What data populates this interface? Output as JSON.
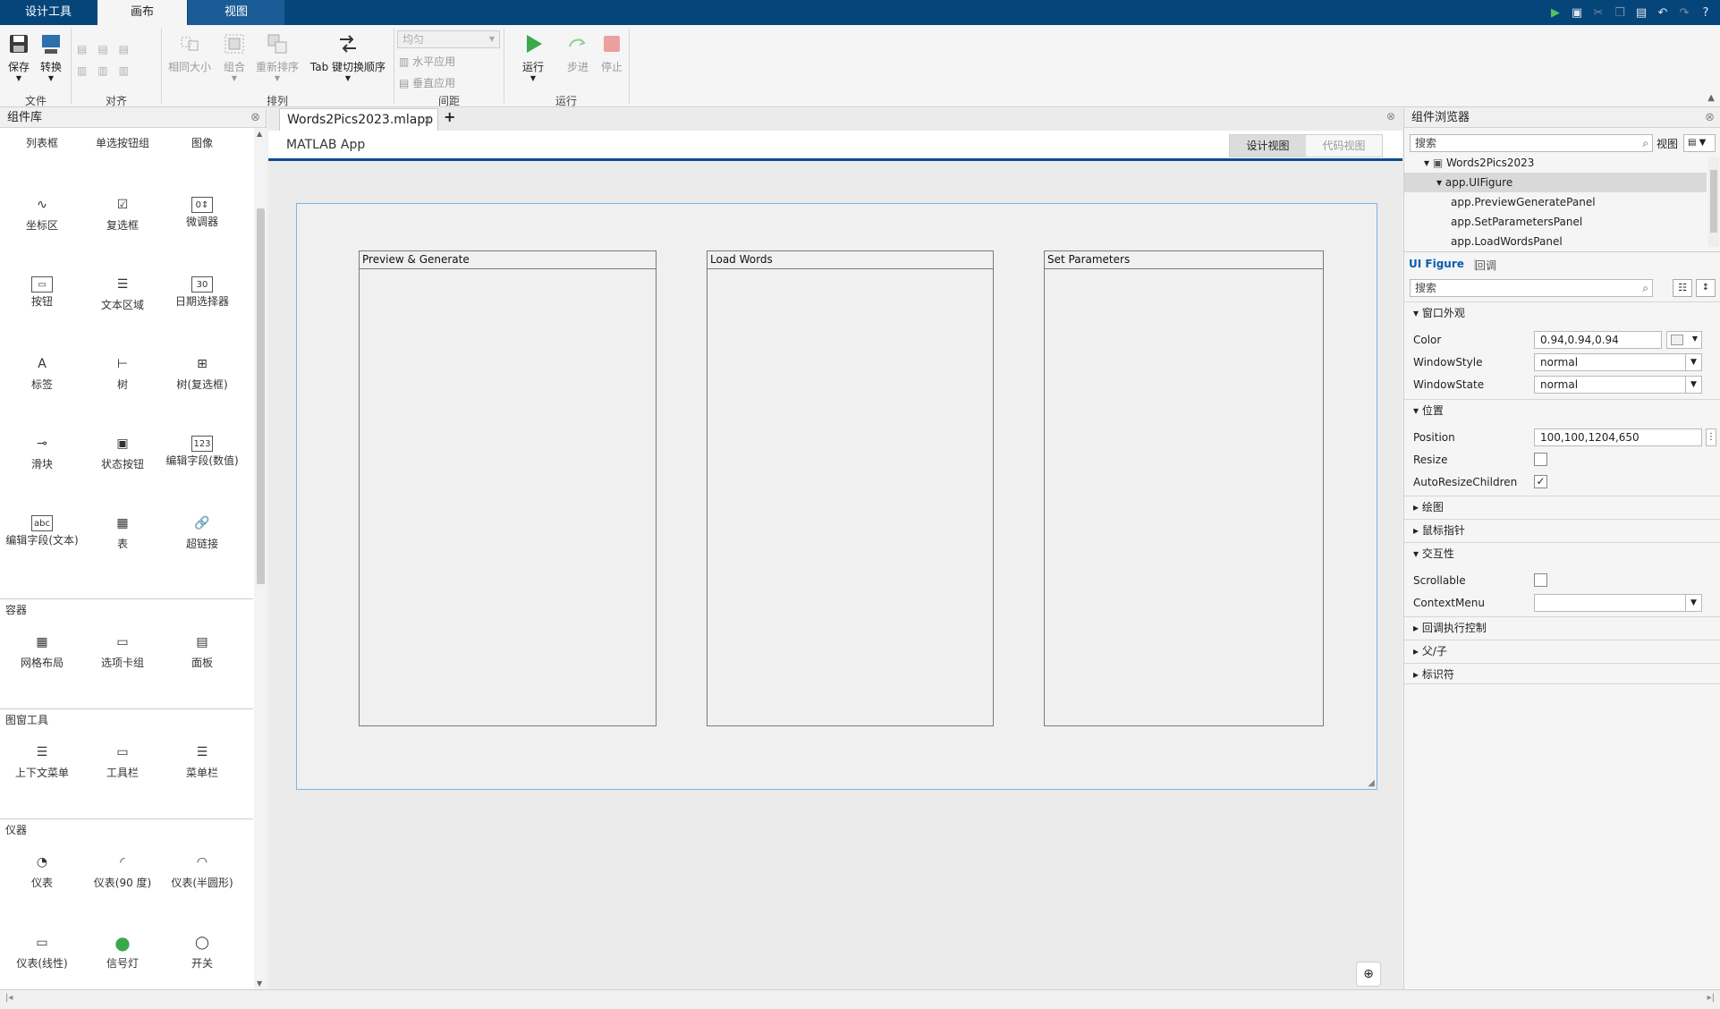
{
  "ribbon_tabs": [
    "设计工具",
    "画布",
    "视图"
  ],
  "ribbon": {
    "save": "保存",
    "convert": "转换",
    "file_group": "文件",
    "align_group": "对齐",
    "same_size": "相同大小",
    "group": "组合",
    "reorder": "重新排序",
    "tab_order": "Tab 键切换顺序",
    "arrange_group": "排列",
    "distribute_value": "均匀",
    "apply_horizontal": "水平应用",
    "apply_vertical": "垂直应用",
    "spacing_group": "间距",
    "run": "运行",
    "step": "步进",
    "stop": "停止",
    "run_group": "运行"
  },
  "library": {
    "title": "组件库",
    "partial": [
      "列表框",
      "单选按钮组",
      "图像"
    ],
    "items": [
      {
        "label": "坐标区",
        "icon": "axes-icon"
      },
      {
        "label": "复选框",
        "icon": "checkbox-icon"
      },
      {
        "label": "微调器",
        "icon": "spinner-icon"
      },
      {
        "label": "按钮",
        "icon": "push-button-icon"
      },
      {
        "label": "文本区域",
        "icon": "text-area-icon"
      },
      {
        "label": "日期选择器",
        "icon": "date-picker-icon"
      },
      {
        "label": "标签",
        "icon": "label-icon"
      },
      {
        "label": "树",
        "icon": "tree-icon"
      },
      {
        "label": "树(复选框)",
        "icon": "tree-checkbox-icon"
      },
      {
        "label": "滑块",
        "icon": "slider-icon"
      },
      {
        "label": "状态按钮",
        "icon": "state-button-icon"
      },
      {
        "label": "编辑字段(数值)",
        "icon": "numeric-field-icon"
      },
      {
        "label": "编辑字段(文本)",
        "icon": "text-field-icon"
      },
      {
        "label": "表",
        "icon": "table-icon"
      },
      {
        "label": "超链接",
        "icon": "hyperlink-icon"
      }
    ],
    "containers_title": "容器",
    "containers": [
      {
        "label": "网格布局",
        "icon": "grid-layout-icon"
      },
      {
        "label": "选项卡组",
        "icon": "tab-group-icon"
      },
      {
        "label": "面板",
        "icon": "panel-icon"
      }
    ],
    "figure_tools_title": "图窗工具",
    "figure_tools": [
      {
        "label": "上下文菜单",
        "icon": "context-menu-icon"
      },
      {
        "label": "工具栏",
        "icon": "toolbar-icon"
      },
      {
        "label": "菜单栏",
        "icon": "menu-bar-icon"
      }
    ],
    "instruments_title": "仪器",
    "instruments": [
      {
        "label": "仪表",
        "icon": "gauge-icon"
      },
      {
        "label": "仪表(90 度)",
        "icon": "gauge-90-icon"
      },
      {
        "label": "仪表(半圆形)",
        "icon": "semicircular-gauge-icon"
      },
      {
        "label": "仪表(线性)",
        "icon": "linear-gauge-icon"
      },
      {
        "label": "信号灯",
        "icon": "lamp-icon"
      },
      {
        "label": "开关",
        "icon": "switch-icon"
      }
    ]
  },
  "document": {
    "tab_name": "Words2Pics2023.mlapp",
    "app_title": "MATLAB App",
    "design_view": "设计视图",
    "code_view": "代码视图",
    "panels": [
      "Preview & Generate",
      "Load Words",
      "Set Parameters"
    ]
  },
  "inspector": {
    "title": "组件浏览器",
    "search_placeholder": "搜索",
    "view_label": "视图",
    "tree": [
      {
        "label": "Words2Pics2023"
      },
      {
        "label": "app.UIFigure"
      },
      {
        "label": "app.PreviewGeneratePanel"
      },
      {
        "label": "app.SetParametersPanel"
      },
      {
        "label": "app.LoadWordsPanel"
      }
    ],
    "sub_tabs": [
      "UI Figure",
      "回调"
    ],
    "prop_search_placeholder": "搜索",
    "groups": {
      "window_appearance": "窗口外观",
      "position": "位置",
      "plotting": "绘图",
      "mouse_pointer": "鼠标指针",
      "interactivity": "交互性",
      "callback_execution": "回调执行控制",
      "parent_child": "父/子",
      "identifiers": "标识符"
    },
    "props": {
      "color_label": "Color",
      "color_value": "0.94,0.94,0.94",
      "windowstyle_label": "WindowStyle",
      "windowstyle_value": "normal",
      "windowstate_label": "WindowState",
      "windowstate_value": "normal",
      "position_label": "Position",
      "position_value": "100,100,1204,650",
      "resize_label": "Resize",
      "resize_checked": false,
      "autoresize_label": "AutoResizeChildren",
      "autoresize_checked": true,
      "scrollable_label": "Scrollable",
      "scrollable_checked": false,
      "contextmenu_label": "ContextMenu",
      "contextmenu_value": ""
    }
  },
  "colors": {
    "titlebar": "#06457a",
    "accent": "#0b4d8c",
    "run_green": "#3aa94a",
    "stop_red": "#e06060"
  }
}
